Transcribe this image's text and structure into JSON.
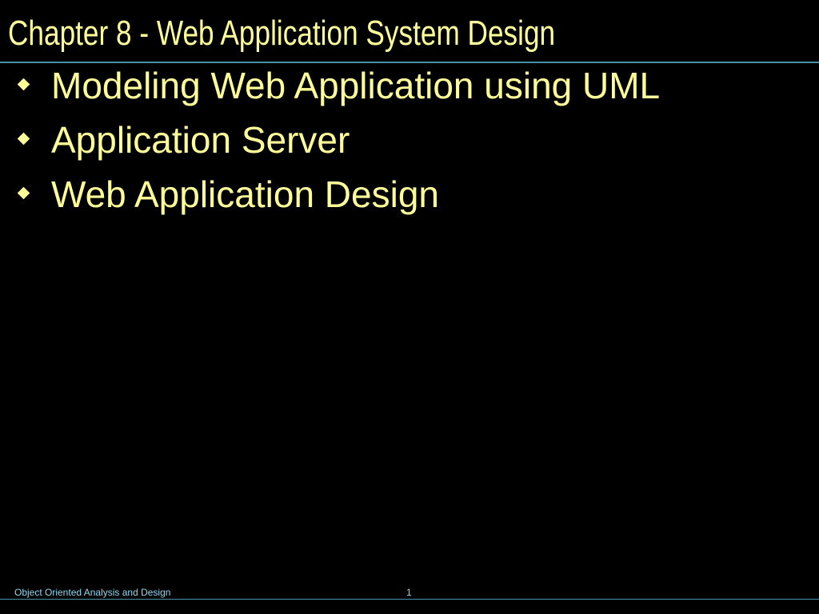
{
  "slide": {
    "title": "Chapter 8 - Web Application System Design",
    "bullets": [
      "Modeling Web Application using UML",
      "Application Server",
      "Web Application Design"
    ],
    "footer_text": "Object Oriented Analysis and Design",
    "page_number": "1",
    "colors": {
      "background": "#000000",
      "text": "#ffff99",
      "rule": "#4a8fa8",
      "footer_text": "#8fd8f0"
    },
    "bullet_icon": "diamond-bullet-icon"
  }
}
